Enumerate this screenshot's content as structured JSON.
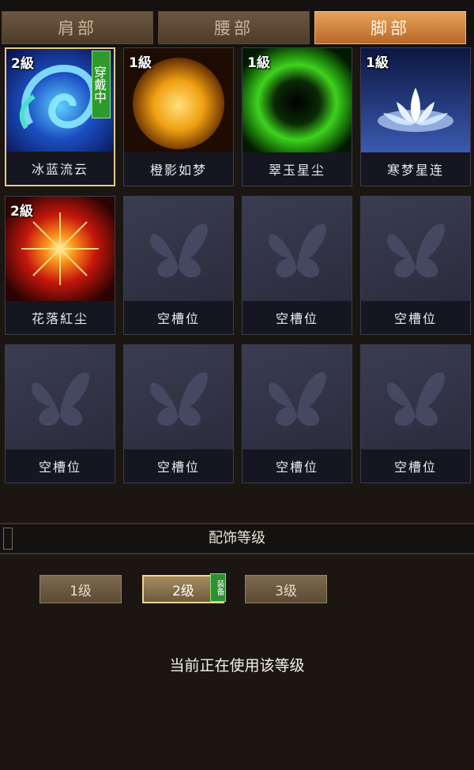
{
  "tabs": [
    {
      "label": "肩部",
      "active": false
    },
    {
      "label": "腰部",
      "active": false
    },
    {
      "label": "脚部",
      "active": true
    }
  ],
  "slots": [
    {
      "name": "冰蓝流云",
      "level": "2級",
      "badge": "穿戴中",
      "art": "blue-swirl-icon"
    },
    {
      "name": "橙影如梦",
      "level": "1級",
      "badge": "",
      "art": "golden-sun-icon"
    },
    {
      "name": "翠玉星尘",
      "level": "1級",
      "badge": "",
      "art": "green-ring-icon"
    },
    {
      "name": "寒梦星连",
      "level": "1級",
      "badge": "",
      "art": "white-lotus-icon"
    },
    {
      "name": "花落紅尘",
      "level": "2級",
      "badge": "",
      "art": "red-burst-icon"
    },
    {
      "name": "空槽位",
      "level": "",
      "badge": "",
      "art": "butterfly-icon"
    },
    {
      "name": "空槽位",
      "level": "",
      "badge": "",
      "art": "butterfly-icon"
    },
    {
      "name": "空槽位",
      "level": "",
      "badge": "",
      "art": "butterfly-icon"
    },
    {
      "name": "空槽位",
      "level": "",
      "badge": "",
      "art": "butterfly-icon"
    },
    {
      "name": "空槽位",
      "level": "",
      "badge": "",
      "art": "butterfly-icon"
    },
    {
      "name": "空槽位",
      "level": "",
      "badge": "",
      "art": "butterfly-icon"
    },
    {
      "name": "空槽位",
      "level": "",
      "badge": "",
      "art": "butterfly-icon"
    }
  ],
  "section": {
    "title": "配饰等级"
  },
  "level_buttons": [
    {
      "label": "1级",
      "current": false
    },
    {
      "label": "2级",
      "current": true
    },
    {
      "label": "3级",
      "current": false
    }
  ],
  "equip_tag": "装备",
  "status_text": "当前正在使用该等级",
  "colors": {
    "accent": "#e7a35a",
    "equipped_green": "#2f9a2c",
    "frame_gold": "#e7c98a"
  }
}
